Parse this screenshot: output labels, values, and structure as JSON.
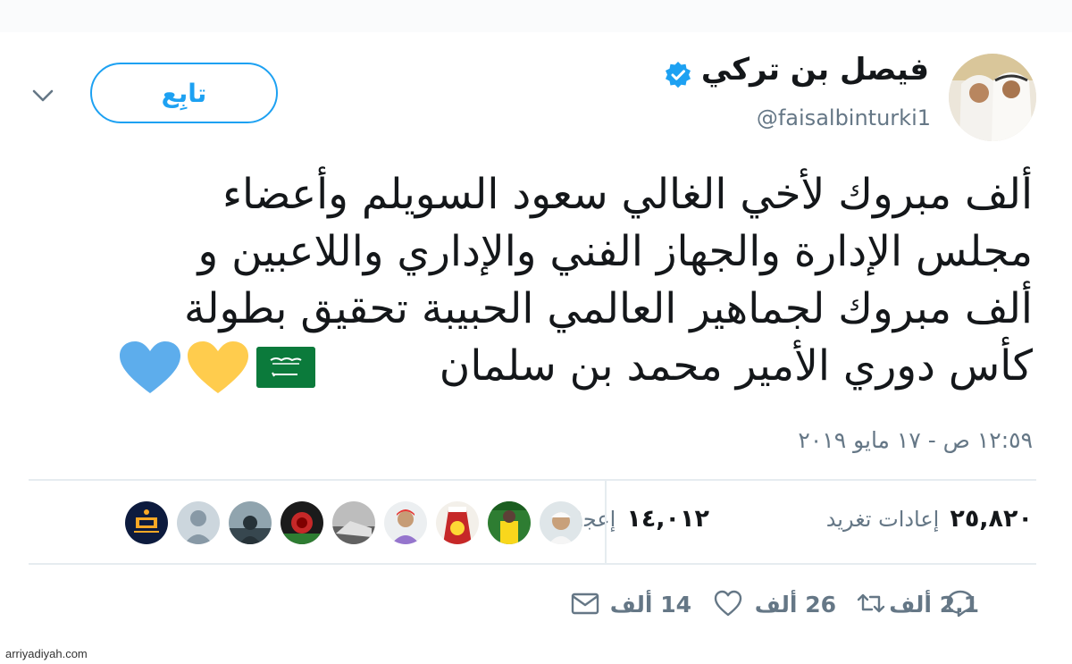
{
  "tweet": {
    "author_name": "فيصل بن تركي",
    "handle": "@faisalbinturki1",
    "follow_label": "تابِع",
    "lines": [
      "ألف مبروك لأخي الغالي سعود السويلم وأعضاء",
      "مجلس الإدارة والجهاز الفني والإداري واللاعبين و",
      "ألف مبروك لجماهير العالمي الحبيبة تحقيق بطولة",
      "كأس دوري الأمير محمد بن سلمان"
    ],
    "timestamp": "١٢:٥٩ ص - ١٧ مايو ٢٠١٩"
  },
  "stats": {
    "retweets_count": "٢٥,٨٢٠",
    "retweets_label": "إعادات تغريد",
    "likes_count": "١٤,٠١٢",
    "likes_label": "إعجابات"
  },
  "actions": {
    "reply_count": "2.1 ألف",
    "retweet_count": "26 ألف",
    "like_count": "14 ألف"
  },
  "colors": {
    "accent": "#1da1f2",
    "muted": "#657786",
    "flag_green": "#0b7a3b",
    "heart_yellow": "#ffcc4d",
    "heart_blue": "#5dadec"
  },
  "icons": [
    "chevron-down-icon",
    "verified-badge-icon",
    "reply-icon",
    "retweet-icon",
    "heart-icon",
    "mail-icon",
    "saudi-flag-icon",
    "yellow-heart-icon",
    "blue-heart-icon"
  ],
  "watermark": "arriyadiyah.com"
}
